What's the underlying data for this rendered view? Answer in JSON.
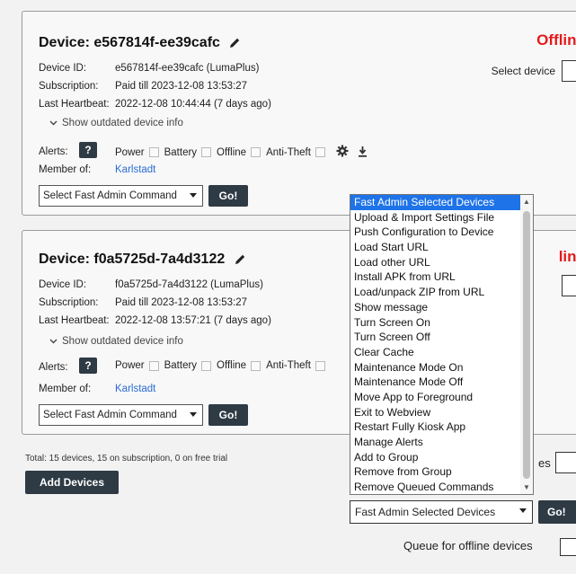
{
  "devices": [
    {
      "title": "Device: e567814f-ee39cafc",
      "status": "Offline",
      "select_label": "Select device",
      "device_id_label": "Device ID:",
      "device_id": "e567814f-ee39cafc (LumaPlus)",
      "subscription_label": "Subscription:",
      "subscription": "Paid till 2023-12-08 13:53:27",
      "heartbeat_label": "Last Heartbeat:",
      "heartbeat": "2022-12-08 10:44:44 (7 days ago)",
      "outdated_toggle": "Show outdated device info",
      "alerts_label": "Alerts:",
      "alerts_help": "?",
      "alert_power": "Power",
      "alert_battery": "Battery",
      "alert_offline": "Offline",
      "alert_antitheft": "Anti-Theft",
      "member_label": "Member of:",
      "member_group": "Karlstadt",
      "command_select": "Select Fast Admin Command",
      "go_label": "Go!"
    },
    {
      "title": "Device: f0a5725d-7a4d3122",
      "status": "line",
      "device_id_label": "Device ID:",
      "device_id": "f0a5725d-7a4d3122 (LumaPlus)",
      "subscription_label": "Subscription:",
      "subscription": "Paid till 2023-12-08 13:53:27",
      "heartbeat_label": "Last Heartbeat:",
      "heartbeat": "2022-12-08 13:57:21 (7 days ago)",
      "outdated_toggle": "Show outdated device info",
      "alerts_label": "Alerts:",
      "alerts_help": "?",
      "alert_power": "Power",
      "alert_battery": "Battery",
      "alert_offline": "Offline",
      "alert_antitheft": "Anti-Theft",
      "member_label": "Member of:",
      "member_group": "Karlstadt",
      "command_select": "Select Fast Admin Command",
      "go_label": "Go!"
    }
  ],
  "footer": {
    "summary": "Total: 15 devices, 15 on subscription, 0 on free trial",
    "add_devices": "Add Devices",
    "side_text": "es"
  },
  "bulk": {
    "options": [
      "Fast Admin Selected Devices",
      "Upload & Import Settings File",
      "Push Configuration to Device",
      "Load Start URL",
      "Load other URL",
      "Install APK from URL",
      "Load/unpack ZIP from URL",
      "Show message",
      "Turn Screen On",
      "Turn Screen Off",
      "Clear Cache",
      "Maintenance Mode On",
      "Maintenance Mode Off",
      "Move App to Foreground",
      "Exit to Webview",
      "Restart Fully Kiosk App",
      "Manage Alerts",
      "Add to Group",
      "Remove from Group",
      "Remove Queued Commands"
    ],
    "selected": "Fast Admin Selected Devices",
    "go_label": "Go!",
    "queue_label": "Queue for offline devices"
  },
  "colors": {
    "offline": "#e31b1b",
    "button": "#2e3a44",
    "highlight": "#1e73e8",
    "link": "#2b6cd3"
  }
}
